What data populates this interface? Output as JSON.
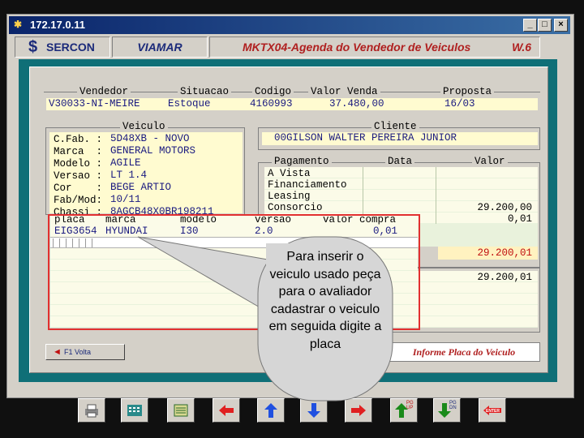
{
  "window": {
    "title": "172.17.0.11"
  },
  "header": {
    "brand": "SERCON",
    "company": "VIAMAR",
    "module": "MKTX04-Agenda do Vendedor de Veiculos",
    "version": "W.6"
  },
  "top_fields": {
    "vendedor_label": "Vendedor",
    "vendedor_value": "V30033-NI-MEIRE",
    "situacao_label": "Situacao",
    "situacao_value": "Estoque",
    "codigo_label": "Codigo",
    "codigo_value": "4160993",
    "valor_venda_label": "Valor Venda",
    "valor_venda_value": "37.480,00",
    "proposta_label": "Proposta",
    "proposta_value": "16/03"
  },
  "veiculo": {
    "title": "Veiculo",
    "rows": [
      {
        "label": "C.Fab. :",
        "value": "5D48XB - NOVO"
      },
      {
        "label": "Marca  :",
        "value": "GENERAL MOTORS"
      },
      {
        "label": "Modelo :",
        "value": "AGILE"
      },
      {
        "label": "Versao :",
        "value": "LT 1.4"
      },
      {
        "label": "Cor    :",
        "value": "BEGE ARTIO"
      },
      {
        "label": "Fab/Mod:",
        "value": "10/11"
      },
      {
        "label": "Chassi :",
        "value": "8AGCB48X0BR198211"
      }
    ]
  },
  "cliente": {
    "title": "Cliente",
    "value": "00GILSON WALTER PEREIRA JUNIOR"
  },
  "pagamento": {
    "title": "Pagamento",
    "data_label": "Data",
    "valor_label": "Valor",
    "rows": [
      {
        "label": "A Vista",
        "valor": ""
      },
      {
        "label": "Financiamento",
        "valor": ""
      },
      {
        "label": "Leasing",
        "valor": ""
      },
      {
        "label": "Consorcio",
        "valor": "29.200,00"
      },
      {
        "label": "",
        "valor": "0,01"
      }
    ],
    "total": "29.200,01",
    "saldo": "29.200,01"
  },
  "usado": {
    "headers": {
      "placa": "placa",
      "marca": "marca",
      "modelo": "modelo",
      "versao": "versao",
      "valor": "valor compra"
    },
    "row": {
      "placa": "EIG3654",
      "marca": "HYUNDAI",
      "modelo": "I30",
      "versao": "2.0",
      "valor": "0,01"
    }
  },
  "buttons": {
    "voltar": "F1 Volta",
    "informe": "Informe Placa do Veiculo"
  },
  "toolbar": {
    "pgup": "PG UP",
    "pgdn": "PG DN",
    "enter": "ENTER"
  },
  "callout": {
    "text": "Para inserir o veiculo usado peça para o avaliador cadastrar o veiculo em seguida digite a placa"
  }
}
